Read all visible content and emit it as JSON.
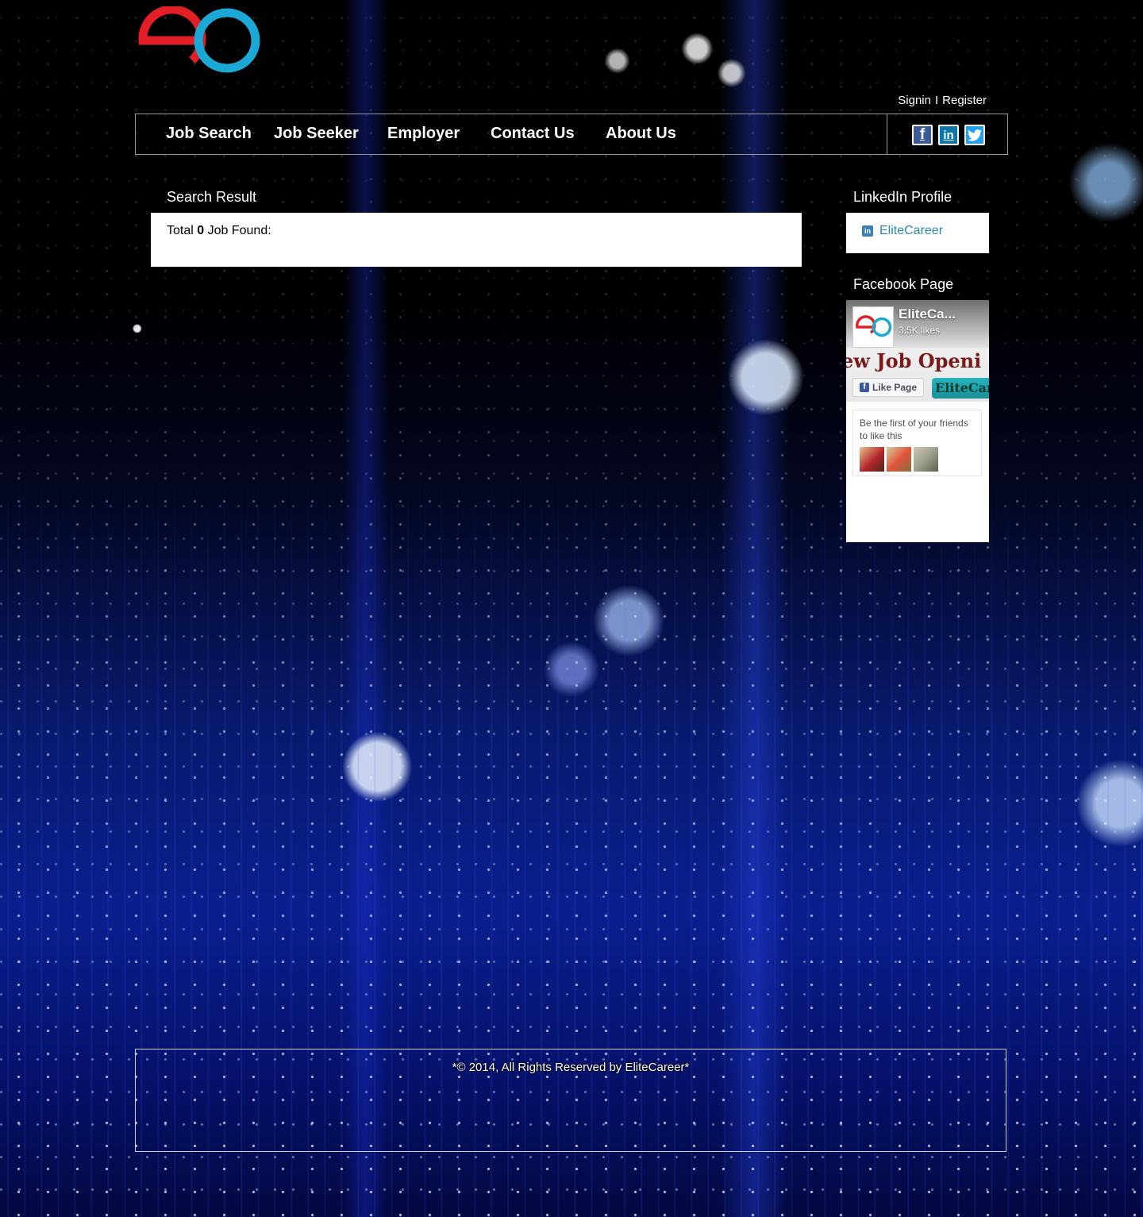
{
  "header": {
    "auth": {
      "signin": "Signin",
      "separator": "I",
      "register": "Register"
    }
  },
  "nav": {
    "items": [
      {
        "label": "Job Search"
      },
      {
        "label": "Job Seeker"
      },
      {
        "label": "Employer"
      },
      {
        "label": "Contact Us"
      },
      {
        "label": "About Us"
      }
    ],
    "social": [
      {
        "icon": "facebook-icon",
        "glyph": "f",
        "color": "#3b5998"
      },
      {
        "icon": "linkedin-icon",
        "glyph": "in",
        "color": "#0e76a8"
      },
      {
        "icon": "twitter-icon",
        "glyph": "t",
        "color": "#1da1f2"
      }
    ]
  },
  "main": {
    "title": "Search Result",
    "results": {
      "prefix": "Total",
      "count": "0",
      "suffix": "Job Found:"
    }
  },
  "sidebar": {
    "linkedin": {
      "title": "LinkedIn Profile",
      "link_label": "EliteCareer"
    },
    "facebook": {
      "title": "Facebook Page",
      "page_name": "EliteCa...",
      "likes": "3.5K likes",
      "cover_text": "New Job Openi",
      "cover_tag": "EliteCar",
      "like_button": "Like Page",
      "friends_text": "Be the first of your friends to like this"
    }
  },
  "footer": {
    "copyright": "*© 2014, All Rights Reserved by EliteCareer*"
  },
  "colors": {
    "logo_red": "#e21f26",
    "logo_blue": "#1ba8d4",
    "link": "#2a8ab0"
  }
}
